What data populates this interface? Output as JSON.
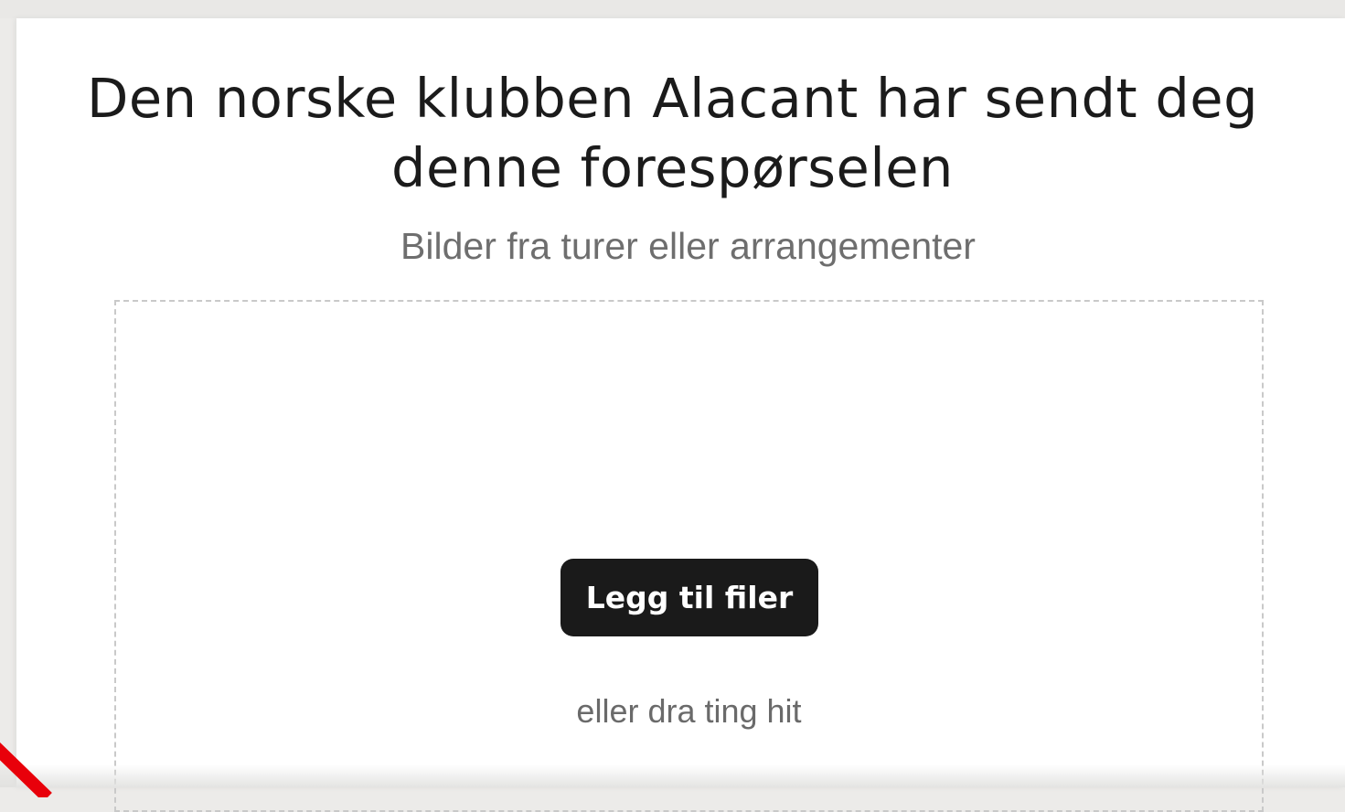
{
  "request": {
    "title": "Den norske klubben Alacant har sendt deg denne forespørselen",
    "subtitle": "Bilder fra turer eller arrangementer"
  },
  "upload": {
    "button_label": "Legg til filer",
    "drag_hint": "eller dra ting hit"
  },
  "colors": {
    "button_bg": "#1a1a1a",
    "button_text": "#ffffff",
    "title_text": "#1b1b1b",
    "muted_text": "#6e6e6e",
    "dropzone_border": "#c9c9c9",
    "page_bg": "#ecebe9",
    "annotation_mark": "#e8000a"
  },
  "icons": {
    "corner_mark": "red-annotation-stroke-icon"
  }
}
